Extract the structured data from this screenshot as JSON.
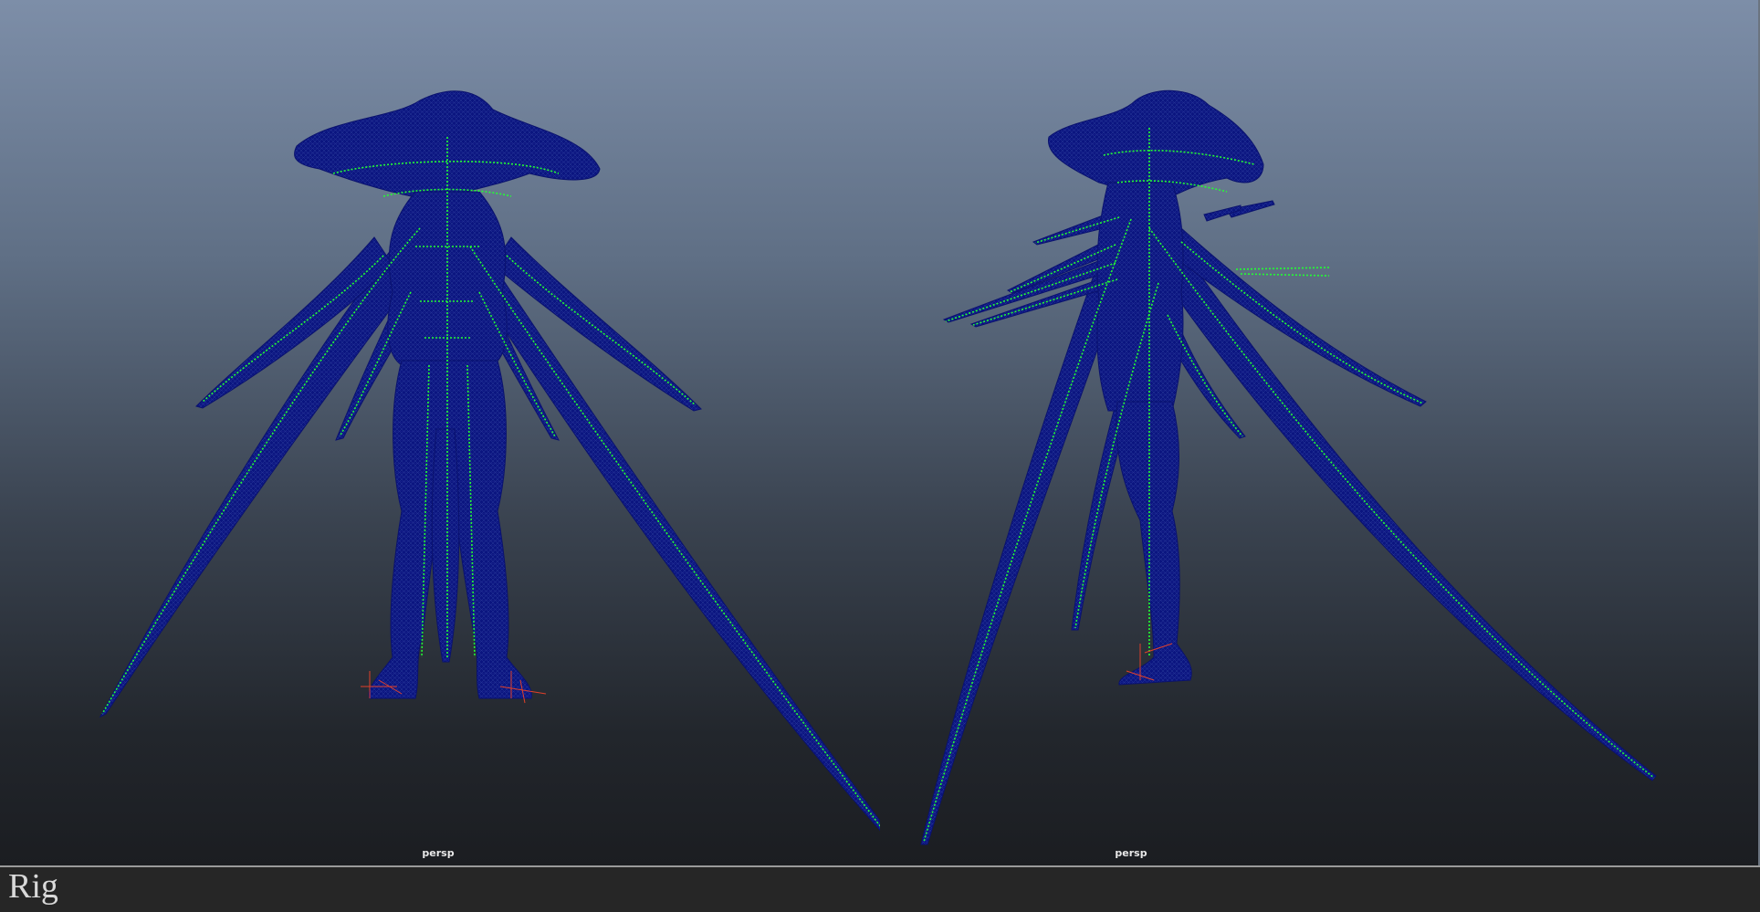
{
  "viewports": [
    {
      "id": "left",
      "camera_label": "persp",
      "view": "front"
    },
    {
      "id": "right",
      "camera_label": "persp",
      "view": "side"
    }
  ],
  "caption": "Rig",
  "colors": {
    "background_top": "#7d8ea8",
    "background_bottom": "#1b1d21",
    "wireframe": "#0a1480",
    "joints": "#22ff33",
    "locators": "#e0402a",
    "caption_bar": "#262626"
  }
}
